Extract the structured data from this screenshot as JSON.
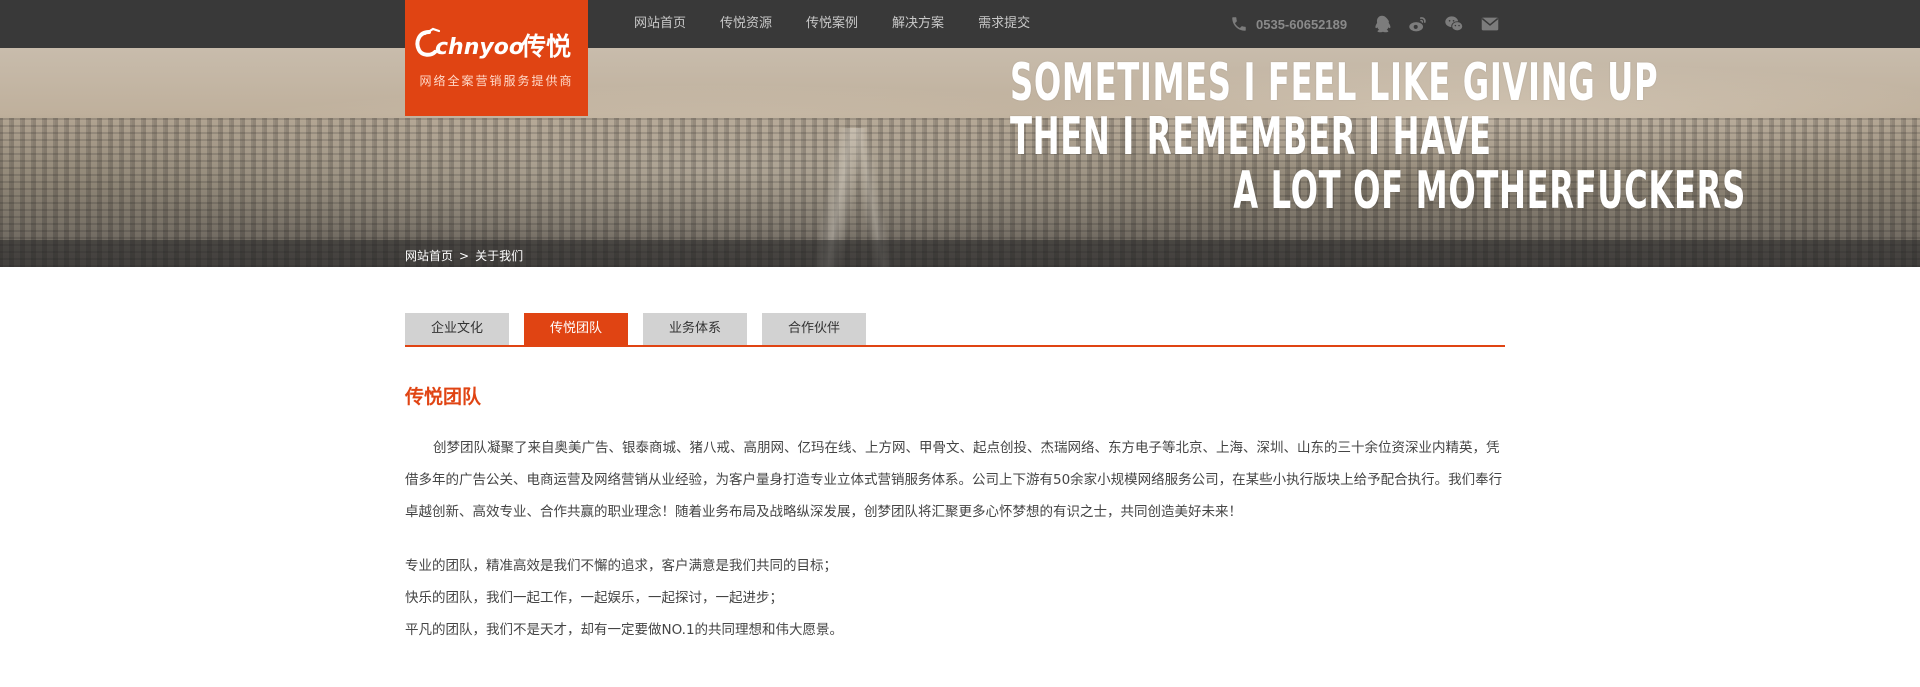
{
  "header": {
    "nav": [
      "网站首页",
      "传悦资源",
      "传悦案例",
      "解决方案",
      "需求提交"
    ],
    "phone": "0535-60652189",
    "social_icons": [
      "qq-icon",
      "weibo-icon",
      "wechat-icon",
      "mail-icon"
    ],
    "phone_icon": "phone-icon"
  },
  "logo": {
    "brand_latin": "chnyoo",
    "brand_cn": "传悦",
    "tagline": "网络全案营销服务提供商",
    "color": "#e04413"
  },
  "banner": {
    "quote_lines": [
      "SOMETIMES I FEEL LIKE GIVING UP",
      "THEN I REMEMBER I HAVE",
      "A LOT OF MOTHERFUCKERS"
    ]
  },
  "breadcrumb": {
    "home": "网站首页",
    "separator": ">",
    "current": "关于我们"
  },
  "tabs": [
    {
      "label": "企业文化",
      "active": false
    },
    {
      "label": "传悦团队",
      "active": true
    },
    {
      "label": "业务体系",
      "active": false
    },
    {
      "label": "合作伙伴",
      "active": false
    }
  ],
  "content": {
    "title": "传悦团队",
    "intro": "创梦团队凝聚了来自奥美广告、银泰商城、猪八戒、高朋网、亿玛在线、上方网、甲骨文、起点创投、杰瑞网络、东方电子等北京、上海、深圳、山东的三十余位资深业内精英，凭借多年的广告公关、电商运营及网络营销从业经验，为客户量身打造专业立体式营销服务体系。公司上下游有50余家小规模网络服务公司，在某些小执行版块上给予配合执行。我们奉行卓越创新、高效专业、合作共赢的职业理念！随着业务布局及战略纵深发展，创梦团队将汇聚更多心怀梦想的有识之士，共同创造美好未来！",
    "motto": [
      "专业的团队，精准高效是我们不懈的追求，客户满意是我们共同的目标；",
      "快乐的团队，我们一起工作，一起娱乐，一起探讨，一起进步；",
      "平凡的团队，我们不是天才，却有一定要做NO.1的共同理想和伟大愿景。"
    ]
  }
}
